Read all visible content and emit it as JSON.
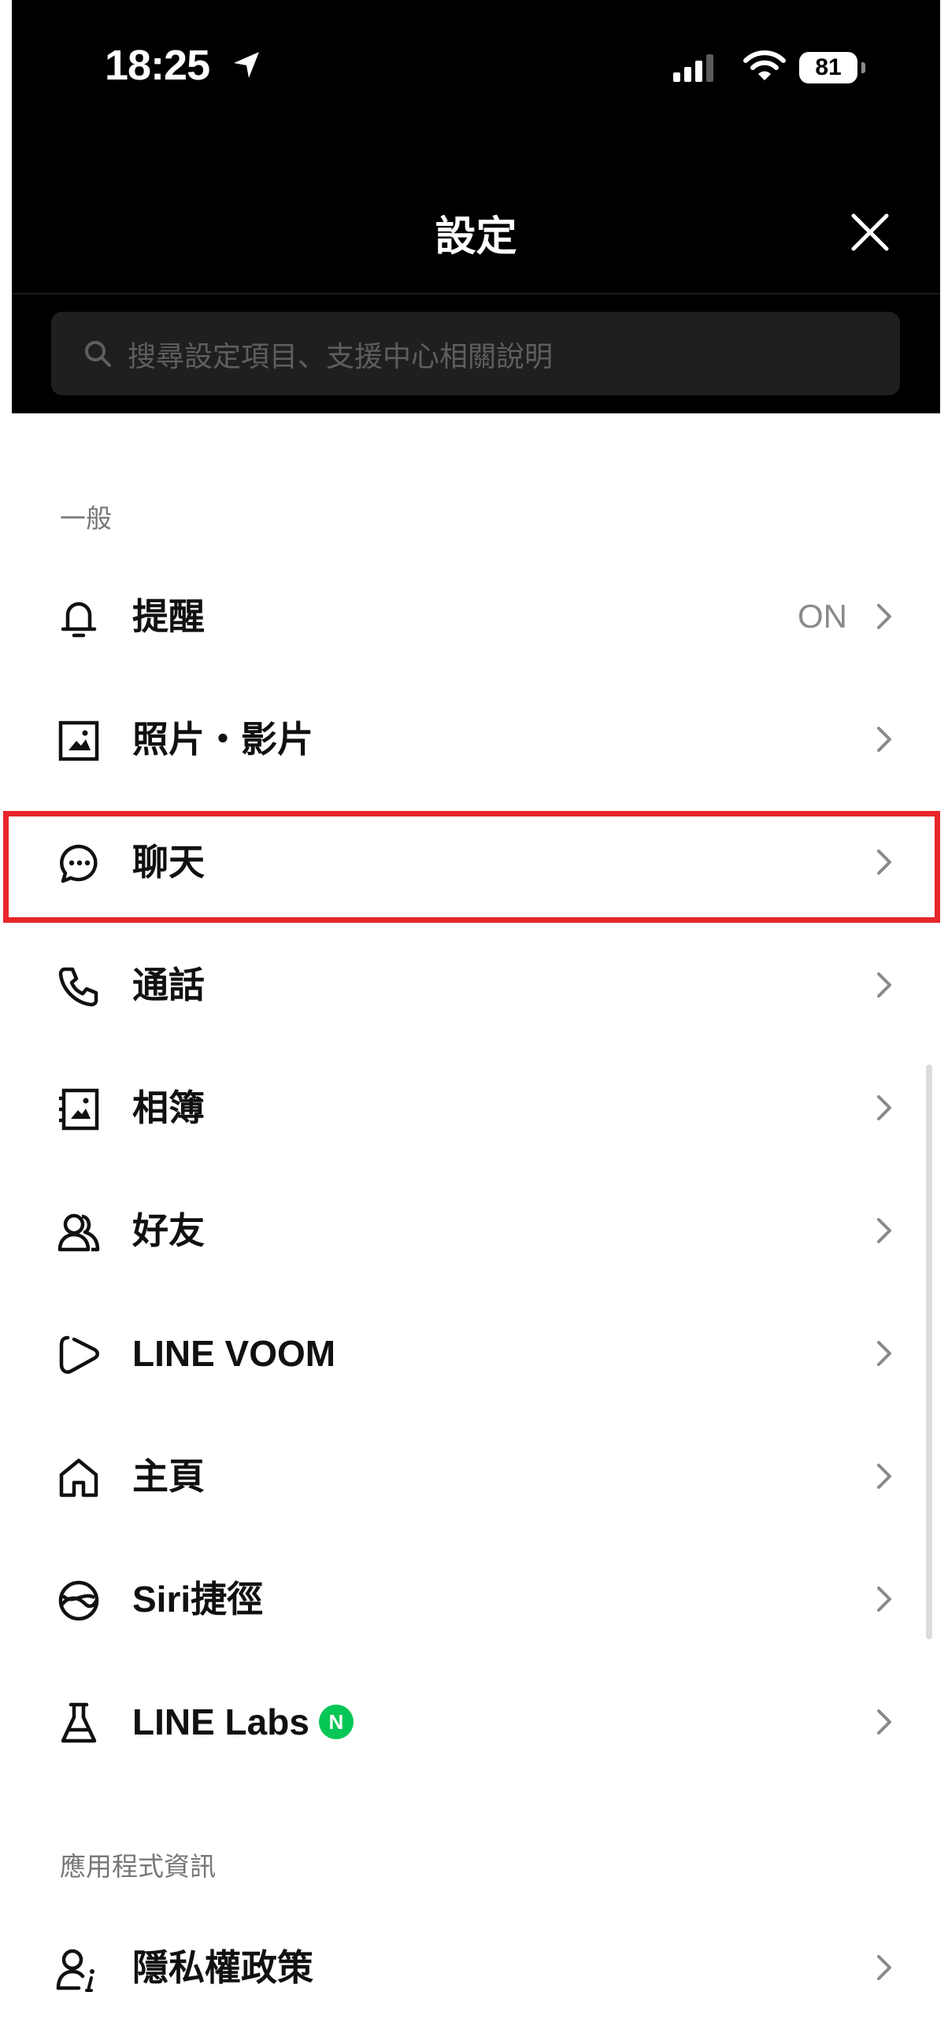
{
  "status_bar": {
    "time": "18:25",
    "battery": "81"
  },
  "nav": {
    "title": "設定"
  },
  "search": {
    "placeholder": "搜尋設定項目、支援中心相關說明"
  },
  "sections": {
    "general": "一般",
    "app_info": "應用程式資訊"
  },
  "items": {
    "notifications": {
      "label": "提醒",
      "value": "ON",
      "icon": "bell-icon"
    },
    "photos": {
      "label": "照片・影片",
      "icon": "image-icon"
    },
    "chats": {
      "label": "聊天",
      "icon": "chat-bubble-icon"
    },
    "calls": {
      "label": "通話",
      "icon": "phone-icon"
    },
    "albums": {
      "label": "相簿",
      "icon": "album-icon"
    },
    "friends": {
      "label": "好友",
      "icon": "friends-icon"
    },
    "voom": {
      "label": "LINE VOOM",
      "icon": "voom-icon"
    },
    "home": {
      "label": "主頁",
      "icon": "home-icon"
    },
    "siri": {
      "label": "Siri捷徑",
      "icon": "siri-icon"
    },
    "labs": {
      "label": "LINE Labs",
      "badge": "N",
      "icon": "flask-icon"
    },
    "privacy": {
      "label": "隱私權政策",
      "icon": "privacy-icon"
    }
  },
  "colors": {
    "highlight": "#e8262b",
    "badge_green": "#06c755",
    "header_bg": "#000000"
  }
}
